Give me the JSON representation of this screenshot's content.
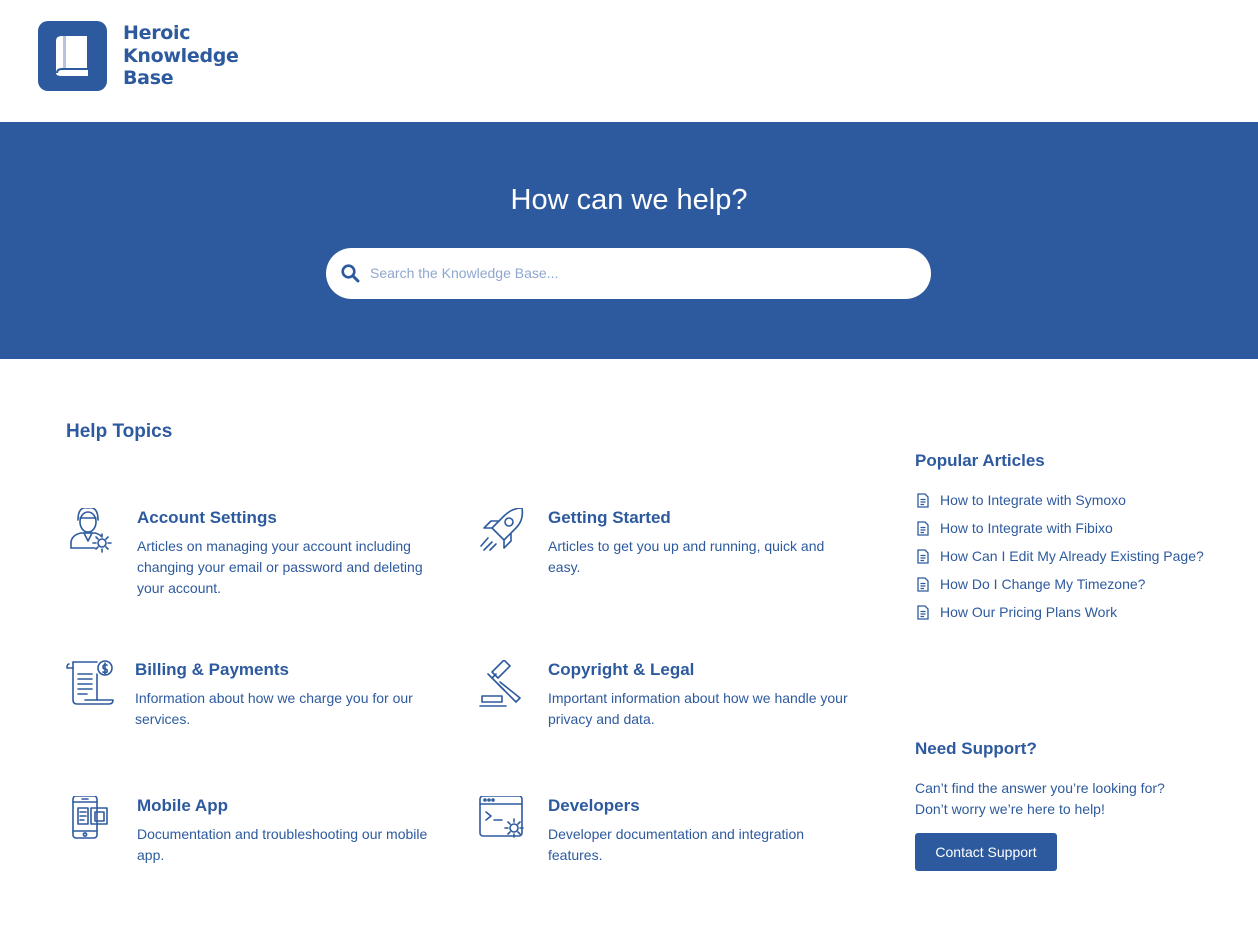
{
  "header": {
    "logo_icon": "book-icon",
    "logo_lines": [
      "Heroic",
      "Knowledge",
      "Base"
    ]
  },
  "hero": {
    "title": "How can we help?",
    "search_icon": "search-icon",
    "search_placeholder": "Search the Knowledge Base..."
  },
  "help_topics": {
    "title": "Help Topics",
    "items": [
      {
        "name": "Account Settings",
        "description": "Articles on managing your account including changing your email or password and deleting your account.",
        "icon": "user-gear-icon"
      },
      {
        "name": "Getting Started",
        "description": "Articles to get you up and running, quick and easy.",
        "icon": "rocket-icon"
      },
      {
        "name": "Billing & Payments",
        "description": "Information about how we charge you for our services.",
        "icon": "invoice-icon"
      },
      {
        "name": "Copyright & Legal",
        "description": "Important information about how we handle your privacy and data.",
        "icon": "gavel-icon"
      },
      {
        "name": "Mobile App",
        "description": "Documentation and troubleshooting our mobile app.",
        "icon": "mobile-icon"
      },
      {
        "name": "Developers",
        "description": "Developer documentation and integration features.",
        "icon": "code-window-icon"
      }
    ]
  },
  "popular_articles": {
    "title": "Popular Articles",
    "icon": "document-icon",
    "items": [
      "How to Integrate with Symoxo",
      "How to Integrate with Fibixo",
      "How Can I Edit My Already Existing Page?",
      "How Do I Change My Timezone?",
      "How Our Pricing Plans Work"
    ]
  },
  "support": {
    "title": "Need Support?",
    "text": "Can’t find the answer you’re looking for? Don’t worry we’re here to help!",
    "button_label": "Contact Support"
  },
  "colors": {
    "brand": "#2d5a9e",
    "background": "#ffffff"
  }
}
